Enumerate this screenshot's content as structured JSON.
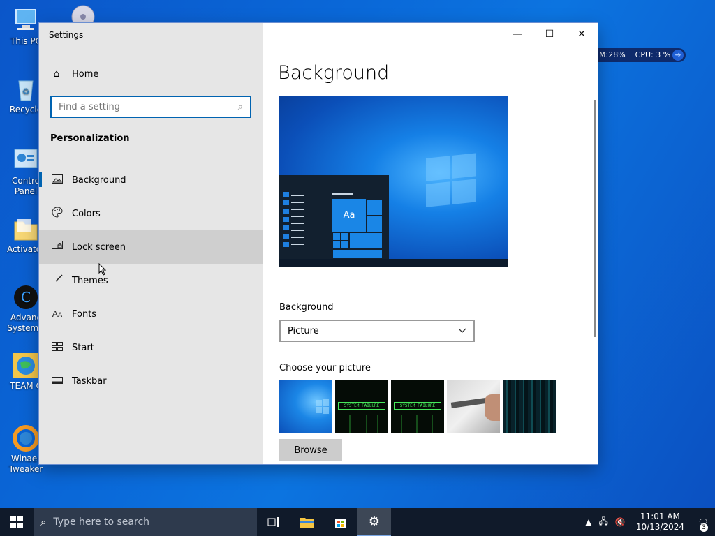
{
  "desktop": {
    "icons": [
      {
        "label": "This PC",
        "icon": "computer-icon"
      },
      {
        "label": "Recycle",
        "icon": "recycle-bin-icon"
      },
      {
        "label": "Contro Panel",
        "icon": "control-panel-icon"
      },
      {
        "label": "Activator",
        "icon": "folder-icon"
      },
      {
        "label": "Advanc SystemC",
        "icon": "advanced-systemcare-icon"
      },
      {
        "label": "TEAM C",
        "icon": "globe-icon"
      },
      {
        "label": "Winaer Tweaker",
        "icon": "winaero-tweaker-icon"
      }
    ],
    "monitor_widget": {
      "mem": "M:28%",
      "cpu": "CPU: 3 %"
    }
  },
  "window": {
    "title": "Settings",
    "sidebar": {
      "home_label": "Home",
      "search_placeholder": "Find a setting",
      "section_title": "Personalization",
      "items": [
        {
          "label": "Background",
          "icon": "picture-icon",
          "selected": true
        },
        {
          "label": "Colors",
          "icon": "palette-icon"
        },
        {
          "label": "Lock screen",
          "icon": "lock-screen-icon",
          "hovered": true
        },
        {
          "label": "Themes",
          "icon": "themes-brush-icon"
        },
        {
          "label": "Fonts",
          "icon": "fonts-icon"
        },
        {
          "label": "Start",
          "icon": "start-grid-icon"
        },
        {
          "label": "Taskbar",
          "icon": "taskbar-icon"
        }
      ]
    },
    "content": {
      "page_title": "Background",
      "preview_tile_text": "Aa",
      "background_label": "Background",
      "background_value": "Picture",
      "choose_label": "Choose your picture",
      "thumb_texts": [
        "SYSTEM FAILURE",
        "SYSTEM FAILURE"
      ],
      "browse_label": "Browse"
    }
  },
  "taskbar": {
    "search_placeholder": "Type here to search",
    "time": "11:01 AM",
    "date": "10/13/2024",
    "notification_count": "3"
  }
}
